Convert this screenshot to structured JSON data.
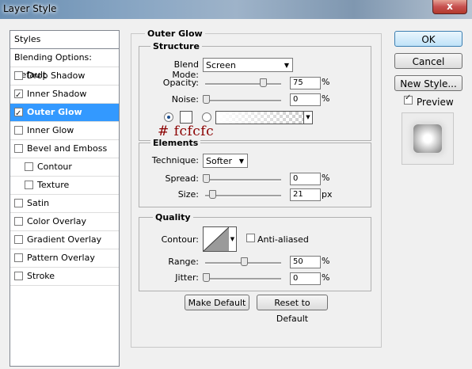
{
  "window": {
    "title": "Layer Style",
    "close_label": "x"
  },
  "sidebar": {
    "header": "Styles",
    "items": [
      {
        "label": "Blending Options: Default",
        "checkbox": false,
        "checked": false,
        "sub": false,
        "active": false
      },
      {
        "label": "Drop Shadow",
        "checkbox": true,
        "checked": false,
        "sub": false,
        "active": false
      },
      {
        "label": "Inner Shadow",
        "checkbox": true,
        "checked": true,
        "sub": false,
        "active": false
      },
      {
        "label": "Outer Glow",
        "checkbox": true,
        "checked": true,
        "sub": false,
        "active": true
      },
      {
        "label": "Inner Glow",
        "checkbox": true,
        "checked": false,
        "sub": false,
        "active": false
      },
      {
        "label": "Bevel and Emboss",
        "checkbox": true,
        "checked": false,
        "sub": false,
        "active": false
      },
      {
        "label": "Contour",
        "checkbox": true,
        "checked": false,
        "sub": true,
        "active": false
      },
      {
        "label": "Texture",
        "checkbox": true,
        "checked": false,
        "sub": true,
        "active": false
      },
      {
        "label": "Satin",
        "checkbox": true,
        "checked": false,
        "sub": false,
        "active": false
      },
      {
        "label": "Color Overlay",
        "checkbox": true,
        "checked": false,
        "sub": false,
        "active": false
      },
      {
        "label": "Gradient Overlay",
        "checkbox": true,
        "checked": false,
        "sub": false,
        "active": false
      },
      {
        "label": "Pattern Overlay",
        "checkbox": true,
        "checked": false,
        "sub": false,
        "active": false
      },
      {
        "label": "Stroke",
        "checkbox": true,
        "checked": false,
        "sub": false,
        "active": false
      }
    ]
  },
  "outer_glow": {
    "title": "Outer Glow",
    "structure": {
      "title": "Structure",
      "blend_mode_label": "Blend Mode:",
      "blend_mode_value": "Screen",
      "opacity_label": "Opacity:",
      "opacity_value": "75",
      "opacity_level": 0.75,
      "noise_label": "Noise:",
      "noise_value": "0",
      "noise_level": 0,
      "percent": "%",
      "color_hex": "#fcfcfc",
      "annotation": "# fcfcfc"
    },
    "elements": {
      "title": "Elements",
      "technique_label": "Technique:",
      "technique_value": "Softer",
      "spread_label": "Spread:",
      "spread_value": "0",
      "spread_level": 0,
      "size_label": "Size:",
      "size_value": "21",
      "size_level": 0.08,
      "percent": "%",
      "px": "px"
    },
    "quality": {
      "title": "Quality",
      "contour_label": "Contour:",
      "anti_aliased_label": "Anti-aliased",
      "range_label": "Range:",
      "range_value": "50",
      "range_level": 0.5,
      "jitter_label": "Jitter:",
      "jitter_value": "0",
      "jitter_level": 0,
      "percent": "%"
    },
    "make_default_label": "Make Default",
    "reset_default_label": "Reset to Default"
  },
  "buttons": {
    "ok": "OK",
    "cancel": "Cancel",
    "new_style": "New Style...",
    "preview": "Preview"
  },
  "colors": {
    "accent": "#3399ff",
    "annotation": "#8b0000",
    "glow": "#fcfcfc"
  }
}
